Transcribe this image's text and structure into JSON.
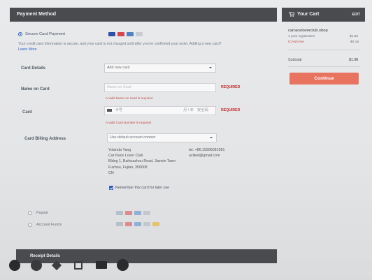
{
  "main": {
    "section_title": "Payment Method",
    "secure": {
      "label": "Secure Card Payment",
      "note": "Your credit card information is secure, and your card is not charged until after you've confirmed your order. Adding a new card?",
      "learn_more": "Learn More"
    },
    "card_details": {
      "label": "Card Details",
      "select_value": "Add new card"
    },
    "name_on_card": {
      "label": "Name on Card",
      "placeholder": "Name on Card",
      "required": "REQUIRED",
      "error": "A valid Name on Card is required"
    },
    "card": {
      "label": "Card",
      "placeholder": "卡号",
      "expiry_placeholder": "月 / 年",
      "cvv_placeholder": "安全码",
      "required": "REQUIRED",
      "error": "A valid Card Number is required"
    },
    "billing": {
      "label": "Card Billing Address",
      "select_value": "Use default account contact",
      "name": "Yolanda Yang",
      "org": "Car Race Lover Club",
      "street": "Bldng 1, Baihuazhou Road, Jianxin Town",
      "city": "Fuzhou, Fujian, 350008",
      "country": "CN",
      "phone": "tel. +86.15906091981",
      "email": "aciiled@gmail.com",
      "remember": "Remember this card for later use"
    },
    "paypal": "Paypal",
    "account_funds": "Account Funds",
    "receipt_title": "Receipt Details"
  },
  "cart": {
    "title": "Your Cart",
    "edit": "EDIT",
    "domain": "carraceloverclub.shop",
    "item1": "1 year registration",
    "item1_price": "$1.80",
    "item2": "ICANN fee",
    "item2_price": "$0.18",
    "subtotal_label": "Subtotal",
    "subtotal_value": "$1.98",
    "continue": "Continue"
  },
  "colors": {
    "header": "#4a4b4f",
    "continue": "#e8735f",
    "required": "#c02a2a",
    "link": "#2a63c8"
  },
  "icons": [
    "cart-icon",
    "visa-icon",
    "mastercard-icon",
    "amex-icon",
    "jcb-icon",
    "paypal-card-icon",
    "back-icon",
    "forward-icon",
    "edit-icon",
    "crop-icon",
    "video-icon",
    "more-icon"
  ]
}
